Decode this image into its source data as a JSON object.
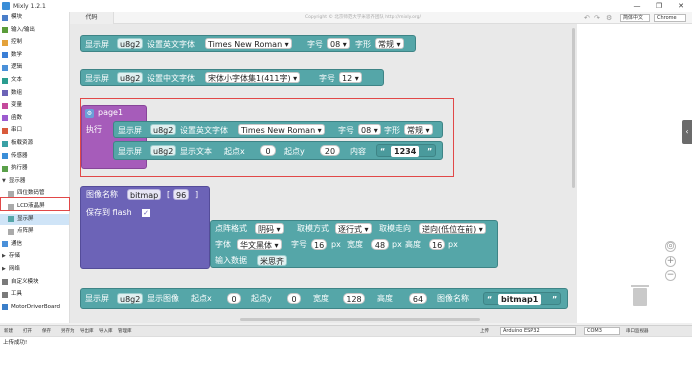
{
  "window": {
    "title": "Mixly 1.2.1",
    "min": "—",
    "max": "❐",
    "close": "✕"
  },
  "toolbar": {
    "code_tab": "代码",
    "copyright": "Copyright © 北京师范大学米思齐团队 http://mixly.org/",
    "lang": "简体中文",
    "browser": "Chrome",
    "undo": "↶",
    "redo": "↷",
    "settings": "⚙"
  },
  "sidebar": {
    "items": [
      {
        "label": "模块",
        "color": "#4a7ec9"
      },
      {
        "label": "输入/输出",
        "color": "#5a9c3a"
      },
      {
        "label": "控制",
        "color": "#e4a23b"
      },
      {
        "label": "数学",
        "color": "#3b7fd6"
      },
      {
        "label": "逻辑",
        "color": "#4a90d9"
      },
      {
        "label": "文本",
        "color": "#2a9d8f"
      },
      {
        "label": "数组",
        "color": "#6c63b7"
      },
      {
        "label": "变量",
        "color": "#c44a9c"
      },
      {
        "label": "函数",
        "color": "#9c5bcf"
      },
      {
        "label": "串口",
        "color": "#d95a3b"
      },
      {
        "label": "板载资源",
        "color": "#3aa0a5"
      },
      {
        "label": "传感器",
        "color": "#3a8ed8"
      },
      {
        "label": "执行器",
        "color": "#5aa04a"
      },
      {
        "label": "显示器",
        "color": "#333333",
        "arrow": "▼"
      },
      {
        "label": "四位数码管",
        "color": "#aaaaaa"
      },
      {
        "label": "LCD液晶屏",
        "color": "#aaaaaa"
      },
      {
        "label": "显示屏",
        "color": "#55a6a8"
      },
      {
        "label": "点阵屏",
        "color": "#aaaaaa"
      },
      {
        "label": "通信",
        "color": "#4a90d9"
      },
      {
        "label": "存储",
        "color": "#333333",
        "arrow": "▶"
      },
      {
        "label": "网络",
        "color": "#333333",
        "arrow": "▶"
      },
      {
        "label": "自定义模块",
        "color": "#7a7a7a"
      },
      {
        "label": "工具",
        "color": "#7a7a7a"
      },
      {
        "label": "MotorDriverBoard",
        "color": "#3a7ec9"
      }
    ]
  },
  "blocks": {
    "b1": {
      "disp": "显示屏",
      "u8g2": "u8g2",
      "setEn": "设置英文字体",
      "font": "Times New Roman ▾",
      "size": "字号",
      "sizeVal": "08 ▾",
      "shape": "字形",
      "shapeVal": "常规 ▾"
    },
    "b2": {
      "disp": "显示屏",
      "u8g2": "u8g2",
      "setCn": "设置中文字体",
      "font": "宋体小字体集1(411字) ▾",
      "size": "字号",
      "sizeVal": "12 ▾"
    },
    "page": {
      "name": "page1",
      "exec": "执行",
      "r1": {
        "disp": "显示屏",
        "u8g2": "u8g2",
        "setEn": "设置英文字体",
        "font": "Times New Roman ▾",
        "size": "字号",
        "sizeVal": "08 ▾",
        "shape": "字形",
        "shapeVal": "常规 ▾"
      },
      "r2": {
        "disp": "显示屏",
        "u8g2": "u8g2",
        "showText": "显示文本",
        "startX": "起点x",
        "x": "0",
        "startY": "起点y",
        "y": "20",
        "content": "内容",
        "text": "1234"
      }
    },
    "bitmap": {
      "name": "图像名称",
      "nameVal": "bitmap",
      "num": "96",
      "save": "保存到 flash",
      "check": "✓",
      "l1": {
        "fmt": "点阵格式",
        "fmtVal": "阴码 ▾",
        "mode": "取模方式",
        "modeVal": "逐行式 ▾",
        "dir": "取模走向",
        "dirVal": "逆向(低位在前) ▾"
      },
      "l2": {
        "font": "字体",
        "fontVal": "华文黑体 ▾",
        "size": "字号",
        "sizeVal": "16",
        "px1": "px",
        "w": "宽度",
        "wVal": "48",
        "px2": "px",
        "h": "高度",
        "hVal": "16",
        "px3": "px"
      },
      "l3": {
        "input": "输入数据",
        "data": "米思齐"
      }
    },
    "b5": {
      "disp": "显示屏",
      "u8g2": "u8g2",
      "showImg": "显示图像",
      "startX": "起点x",
      "x": "0",
      "startY": "起点y",
      "y": "0",
      "w": "宽度",
      "wVal": "128",
      "h": "高度",
      "hVal": "64",
      "imgName": "图像名称",
      "imgVal": "bitmap1"
    }
  },
  "bottom": {
    "buttons": [
      "新建",
      "打开",
      "保存",
      "另存为",
      "导出库",
      "导入库",
      "管理库"
    ],
    "upload": "上传",
    "board": "Arduino ESP32",
    "port": "COM3",
    "monitor": "串口监视器"
  },
  "console": {
    "text": "上传成功!"
  }
}
